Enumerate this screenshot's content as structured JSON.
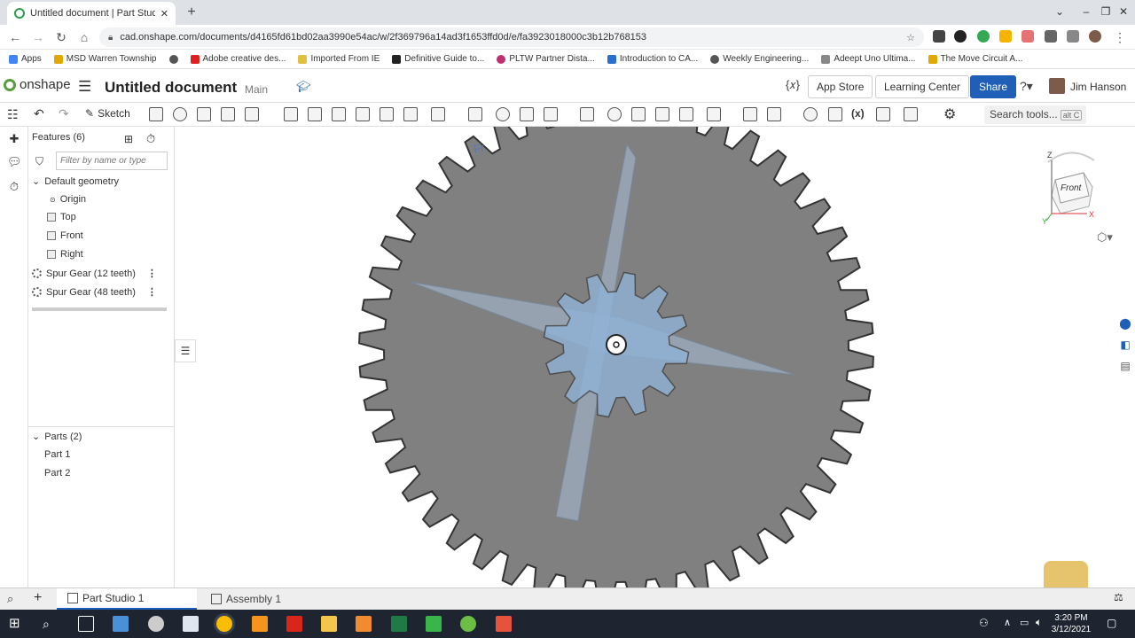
{
  "browser": {
    "tab_title": "Untitled document | Part Studio",
    "new_tab": "+",
    "url": "cad.onshape.com/documents/d4165fd61bd02aa3990e54ac/w/2f369796a14ad3f1653ffd0d/e/fa3923018000c3b12b768153",
    "window_controls": [
      "–",
      "❐",
      "✕"
    ]
  },
  "bookmarks": [
    {
      "label": "Apps",
      "color": "#4285f4"
    },
    {
      "label": "MSD Warren Township",
      "color": "#e0a800"
    },
    {
      "label": "",
      "color": "#555555"
    },
    {
      "label": "Adobe creative des...",
      "color": "#e02020"
    },
    {
      "label": "Imported From IE",
      "color": "#e0c040"
    },
    {
      "label": "Definitive Guide to...",
      "color": "#222222"
    },
    {
      "label": "PLTW Partner Dista...",
      "color": "#c03070"
    },
    {
      "label": "Introduction to CA...",
      "color": "#2a6fd0"
    },
    {
      "label": "Weekly Engineering...",
      "color": "#555555"
    },
    {
      "label": "Adeept Uno Ultima...",
      "color": "#888888"
    },
    {
      "label": "The Move Circuit A...",
      "color": "#e0a800"
    }
  ],
  "onshape": {
    "logo_text": "onshape",
    "document_title": "Untitled document",
    "workspace": "Main",
    "app_store": "App Store",
    "learning_center": "Learning Center",
    "share": "Share",
    "user_name": "Jim Hanson",
    "variable_icon": "{𝑥}"
  },
  "toolbar": {
    "sketch_label": "Sketch",
    "search_tools": "Search tools...",
    "search_shortcut": "alt C"
  },
  "features": {
    "header": "Features (6)",
    "filter_placeholder": "Filter by name or type",
    "default_geometry": "Default geometry",
    "items": [
      "Origin",
      "Top",
      "Front",
      "Right",
      "Spur Gear (12 teeth)",
      "Spur Gear (48 teeth)"
    ],
    "parts_header": "Parts (2)",
    "parts": [
      "Part 1",
      "Part 2"
    ]
  },
  "viewport": {
    "plane_label": "Fr",
    "viewcube_face": "Front",
    "axes": [
      "Z",
      "Y",
      "X"
    ],
    "gear_color": "#808080",
    "small_gear_color": "#8fb2d6"
  },
  "bottom_tabs": [
    "Part Studio 1",
    "Assembly 1"
  ],
  "taskbar": {
    "time": "3:20 PM",
    "date": "3/12/2021"
  }
}
